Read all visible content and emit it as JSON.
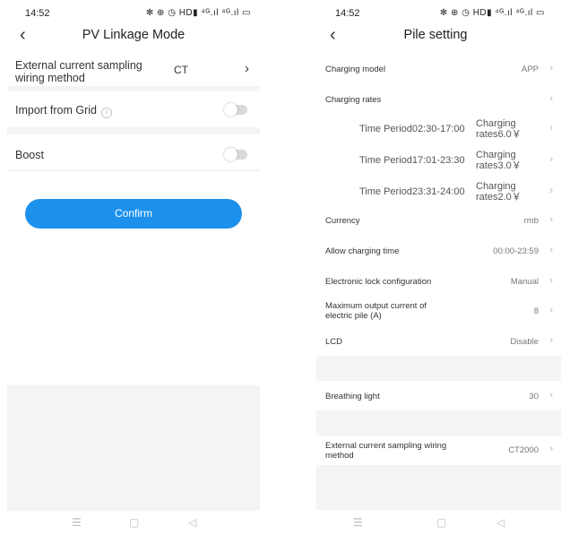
{
  "left": {
    "status": {
      "time": "14:52",
      "icons": "✻ ⊕ ◷ HD▮ ⁴ᴳ.ıl ⁴ᴳ.ıl ▭"
    },
    "nav": {
      "title": "PV Linkage Mode"
    },
    "rows": {
      "sampling_label": "External current sampling wiring method",
      "sampling_value": "CT",
      "import_label": "Import from Grid",
      "import_on": false,
      "boost_label": "Boost",
      "boost_on": false
    },
    "confirm_label": "Confirm"
  },
  "right": {
    "status": {
      "time": "14:52",
      "icons": "✻ ⊕ ◷ HD▮ ⁴ᴳ.ıl ⁴ᴳ.ıl ▭"
    },
    "nav": {
      "title": "Pile setting"
    },
    "charging_model": {
      "label": "Charging model",
      "value": "APP"
    },
    "charging_rates": {
      "label": "Charging rates"
    },
    "periods": [
      {
        "label": "Time Period02:30-17:00",
        "rate_line1": "Charging",
        "rate_line2": "rates6.0￥"
      },
      {
        "label": "Time Period17:01-23:30",
        "rate_line1": "Charging",
        "rate_line2": "rates3.0￥"
      },
      {
        "label": "Time Period23:31-24:00",
        "rate_line1": "Charging",
        "rate_line2": "rates2.0￥"
      }
    ],
    "currency": {
      "label": "Currency",
      "value": "rmb"
    },
    "allow_time": {
      "label": "Allow charging time",
      "value": "00:00-23:59"
    },
    "lock": {
      "label": "Electronic lock configuration",
      "value": "Manual"
    },
    "max_current": {
      "label_line1": "Maximum output current of",
      "label_line2": "electric pile (A)",
      "value": "8"
    },
    "lcd": {
      "label": "LCD",
      "value": "Disable"
    },
    "breathing": {
      "label": "Breathing light",
      "value": "30"
    },
    "sampling": {
      "label_line1": "External current sampling wiring",
      "label_line2": "method",
      "value": "CT2000"
    }
  },
  "navbar": {
    "menu": "☰",
    "home": "▢",
    "back": "◁"
  },
  "colors": {
    "accent": "#1c91ec",
    "background_gray": "#f4f4f4",
    "toggle_off": "#d9d9d9"
  },
  "icons": [
    "back-icon",
    "info-icon",
    "chevron-right-icon",
    "menu-icon",
    "home-icon",
    "nav-back-icon"
  ]
}
